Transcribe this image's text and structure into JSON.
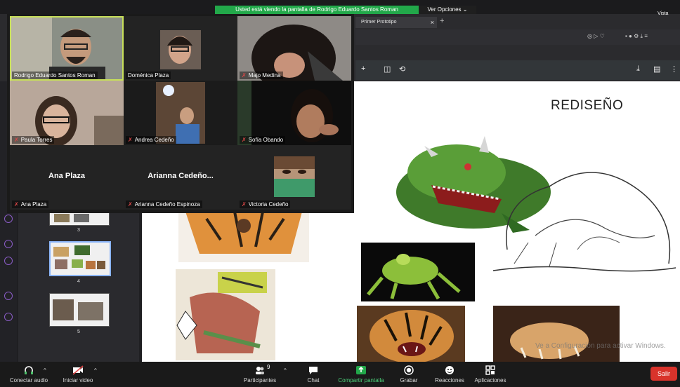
{
  "banner": {
    "text": "Usted está viendo la pantalla de Rodrigo Eduardo Santos Roman",
    "view_options": "Ver Opciones ⌄"
  },
  "browser": {
    "tab_title": "Primer Prototipo",
    "window_label": "Vista"
  },
  "slide": {
    "title": "REDISEÑO",
    "watermark": "Ve a Configuración para activar Windows."
  },
  "thumbnails": [
    {
      "num": "3"
    },
    {
      "num": "4"
    },
    {
      "num": "5"
    }
  ],
  "participants": [
    {
      "name": "Rodrigo Eduardo Santos Roman",
      "muted": false,
      "active": true
    },
    {
      "name": "Doménica Plaza",
      "muted": false
    },
    {
      "name": "Majo Medina",
      "muted": true
    },
    {
      "name": "Paula Torres",
      "muted": true
    },
    {
      "name": "Andrea Cedeño",
      "muted": true
    },
    {
      "name": "Sofía Obando",
      "muted": true
    },
    {
      "name": "Ana Plaza",
      "muted": true,
      "display_name": "Ana Plaza"
    },
    {
      "name": "Arianna Cedeño Espinoza",
      "muted": true,
      "display_name": "Arianna  Cedeño..."
    },
    {
      "name": "Victoria Cedeño",
      "muted": true
    }
  ],
  "toolbar": {
    "audio": "Conectar audio",
    "video": "Iniciar video",
    "participants": "Participantes",
    "participants_count": "9",
    "chat": "Chat",
    "share": "Compartir pantalla",
    "record": "Grabar",
    "reactions": "Reacciones",
    "apps": "Aplicaciones",
    "leave": "Salir"
  },
  "colors": {
    "banner_green": "#22a84a",
    "active_speaker": "#c8e05a",
    "leave_red": "#d9332b",
    "muted_red": "#e04848"
  }
}
